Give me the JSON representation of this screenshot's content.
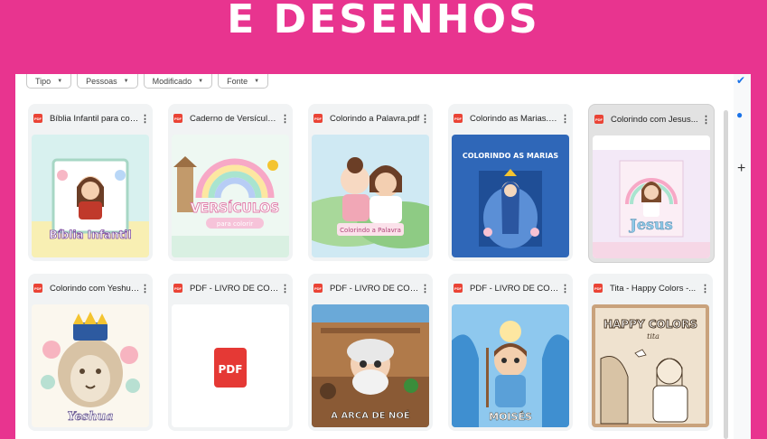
{
  "banner": {
    "title": "E DESENHOS"
  },
  "filters": [
    {
      "label": "Tipo"
    },
    {
      "label": "Pessoas"
    },
    {
      "label": "Modificado"
    },
    {
      "label": "Fonte"
    }
  ],
  "files": [
    {
      "name": "Bíblia Infantil para colori...",
      "thumb_text": "Bíblia Infantil",
      "badge": "PDF"
    },
    {
      "name": "Caderno de Versículos...",
      "thumb_text": "VERSÍCULOS",
      "thumb_sub": "para colorir",
      "badge": "PDF"
    },
    {
      "name": "Colorindo a Palavra.pdf",
      "thumb_text": "Colorindo a Palavra",
      "badge": "PDF"
    },
    {
      "name": "Colorindo as Marias.pdf",
      "thumb_text": "COLORINDO AS MARIAS",
      "badge": "PDF"
    },
    {
      "name": "Colorindo com Jesus...",
      "thumb_text": "Jesus",
      "badge": "PDF"
    },
    {
      "name": "Colorindo com Yeshua.pdf",
      "thumb_text": "Yeshua",
      "badge": "PDF"
    },
    {
      "name": "PDF - LIVRO DE COLORI...",
      "thumb_text": "PDF",
      "badge": "PDF"
    },
    {
      "name": "PDF - LIVRO DE COLORI...",
      "thumb_text": "A ARCA DE NOÉ",
      "badge": "PDF"
    },
    {
      "name": "PDF - LIVRO DE COLORI...",
      "thumb_text": "MOISÉS",
      "badge": "PDF"
    },
    {
      "name": "Tita - Happy Colors -...",
      "thumb_text": "HAPPY COLORS",
      "thumb_sub": "tita",
      "badge": "PDF"
    }
  ],
  "icons": {
    "more": "more-vert-icon",
    "pdf": "pdf-file-icon",
    "add": "plus-icon"
  },
  "colors": {
    "accent": "#e8348f",
    "pdf_red": "#ea4335",
    "drive_blue": "#1a73e8"
  },
  "rail": {
    "plus": "+"
  }
}
